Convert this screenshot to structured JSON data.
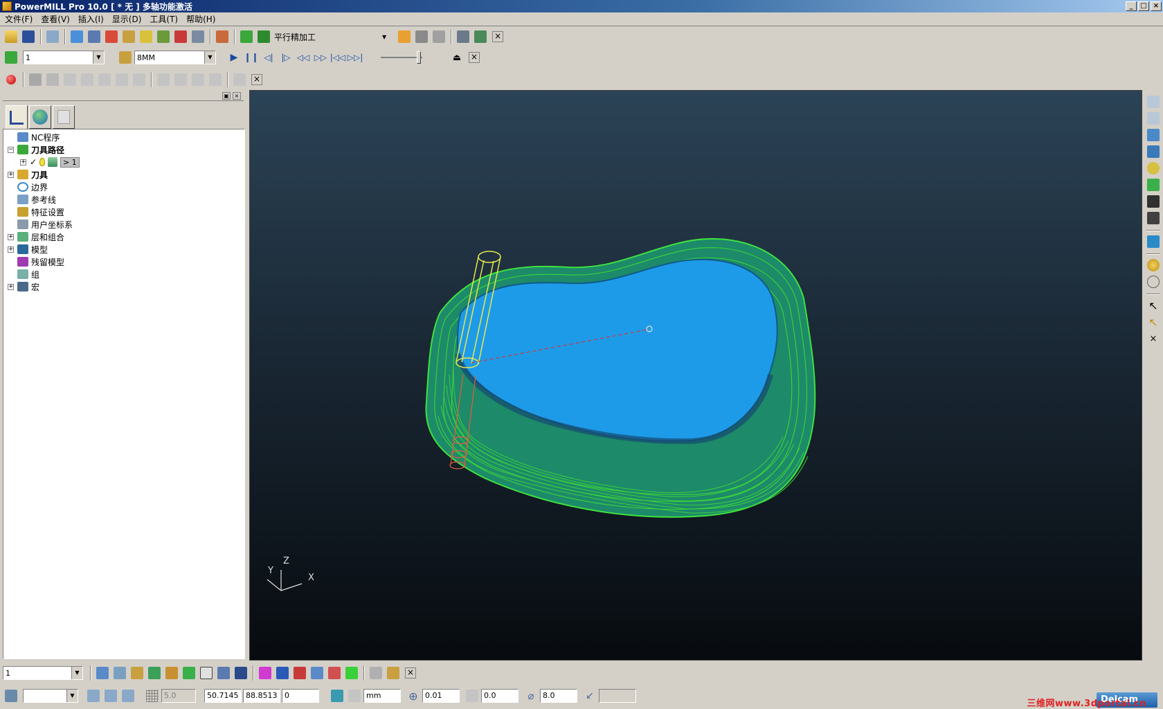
{
  "window": {
    "title": "PowerMILL Pro 10.0   [ * 无 ]   多轴功能激活"
  },
  "menu": [
    "文件(F)",
    "查看(V)",
    "插入(I)",
    "显示(D)",
    "工具(T)",
    "帮助(H)"
  ],
  "toolbar_main": {
    "strategy_label": "平行精加工"
  },
  "toolbar_sim": {
    "toolpath_value": "1",
    "tool_value": "8MM"
  },
  "explorer": {
    "tree": [
      {
        "label": "NC程序",
        "bold": false
      },
      {
        "label": "刀具路径",
        "bold": true
      },
      {
        "label": "> 1",
        "bold": false
      },
      {
        "label": "刀具",
        "bold": true
      },
      {
        "label": "边界",
        "bold": false
      },
      {
        "label": "参考线",
        "bold": false
      },
      {
        "label": "特征设置",
        "bold": false
      },
      {
        "label": "用户坐标系",
        "bold": false
      },
      {
        "label": "层和组合",
        "bold": false
      },
      {
        "label": "模型",
        "bold": false
      },
      {
        "label": "残留模型",
        "bold": false
      },
      {
        "label": "组",
        "bold": false
      },
      {
        "label": "宏",
        "bold": false
      }
    ]
  },
  "viewport": {
    "axes": {
      "x": "X",
      "y": "Y",
      "z": "Z"
    }
  },
  "bottom_toolbar": {
    "workplane_value": "1"
  },
  "status_bar": {
    "grid": "5.0",
    "x": "50.7145",
    "y": "88.8513",
    "z": "0",
    "units": "mm",
    "tolerance": "0.01",
    "thickness": "0.0",
    "diameter": "8.0"
  },
  "branding": {
    "logo": "Delcam",
    "watermark": "三维网www.3dportal.cn"
  },
  "colors": {
    "model_top": "#1e9be8",
    "toolpath": "#3fe23f",
    "tool": "#e8e84a",
    "holder": "#e85a3a"
  }
}
